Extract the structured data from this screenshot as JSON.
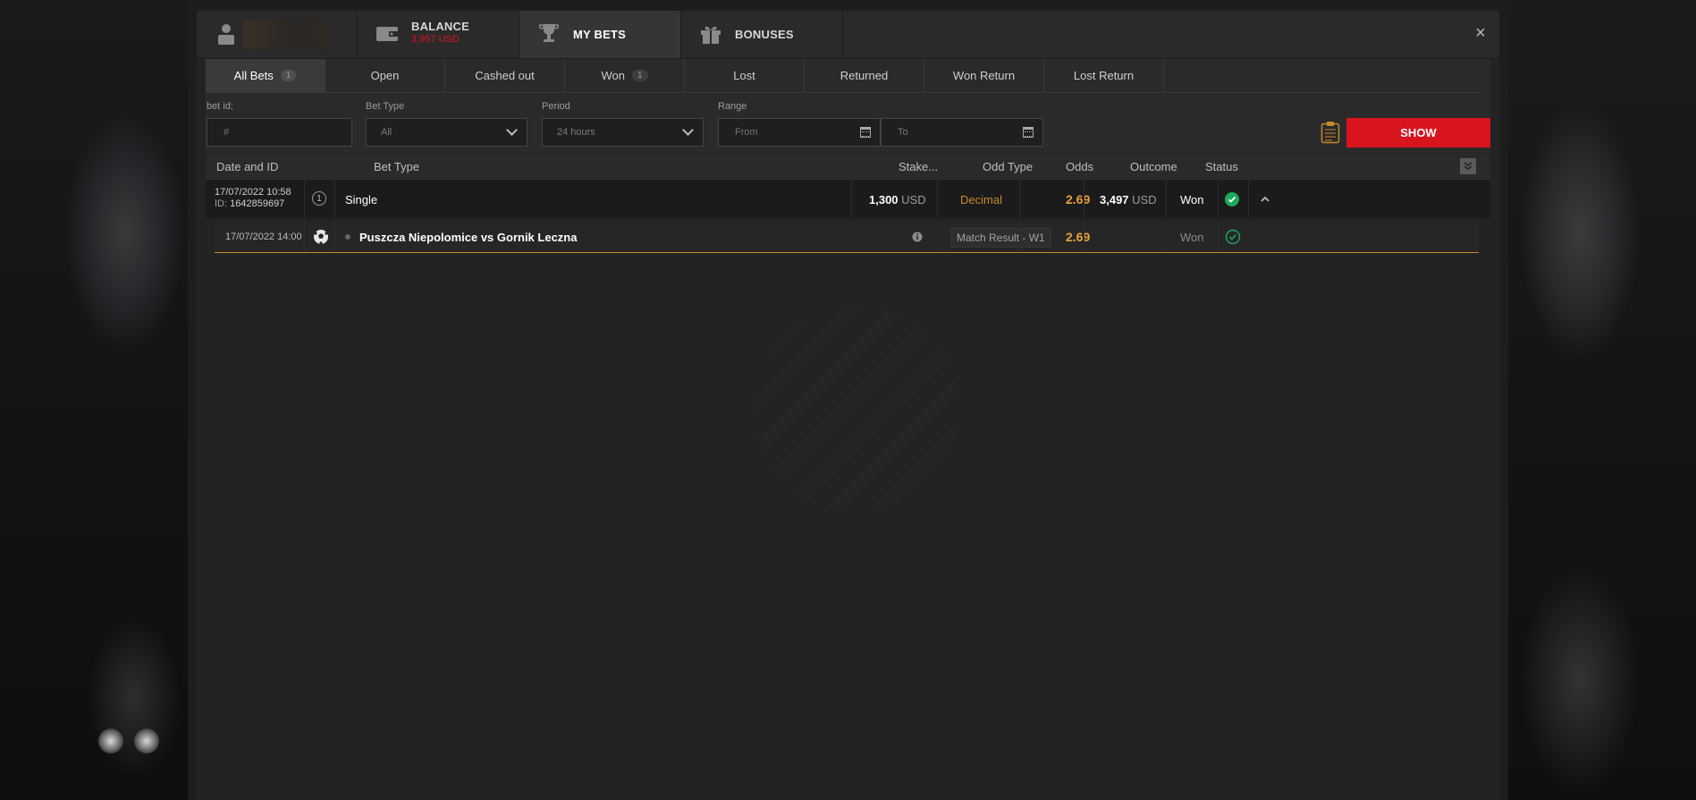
{
  "header": {
    "balance_label": "BALANCE",
    "balance_value": "3,957 USD",
    "mybets_label": "MY BETS",
    "bonuses_label": "BONUSES",
    "close": "×"
  },
  "status_tabs": [
    {
      "label": "All Bets",
      "count": "1"
    },
    {
      "label": "Open",
      "count": ""
    },
    {
      "label": "Cashed out",
      "count": ""
    },
    {
      "label": "Won",
      "count": "1"
    },
    {
      "label": "Lost",
      "count": ""
    },
    {
      "label": "Returned",
      "count": ""
    },
    {
      "label": "Won Return",
      "count": ""
    },
    {
      "label": "Lost Return",
      "count": ""
    }
  ],
  "filters": {
    "bet_id_label": "bet id:",
    "bet_id_placeholder": "#",
    "bet_type_label": "Bet Type",
    "bet_type_value": "All",
    "period_label": "Period",
    "period_value": "24 hours",
    "range_label": "Range",
    "from_placeholder": "From",
    "to_placeholder": "To",
    "show": "SHOW"
  },
  "table": {
    "headers": {
      "date_id": "Date and ID",
      "bet_type": "Bet Type",
      "stake": "Stake...",
      "odd_type": "Odd Type",
      "odds": "Odds",
      "outcome": "Outcome",
      "status": "Status"
    },
    "bet": {
      "datetime": "17/07/2022 10:58",
      "id_label": "ID:",
      "id": "1642859697",
      "type_icon": "1",
      "type": "Single",
      "stake": "1,300",
      "stake_currency": "USD",
      "odd_type": "Decimal",
      "odds": "2.69",
      "outcome": "3,497",
      "outcome_currency": "USD",
      "status": "Won",
      "status_color": "#1fa85a"
    },
    "event": {
      "datetime": "17/07/2022 14:00",
      "match": "Puszcza Niepolomice vs Gornik Leczna",
      "market": "Match Result - W1",
      "odds": "2.69",
      "status": "Won",
      "sport_icon": "soccer-ball-icon"
    }
  },
  "colors": {
    "accent_red": "#d8141e",
    "gold": "#e8a13a",
    "won_green": "#1fa85a"
  }
}
